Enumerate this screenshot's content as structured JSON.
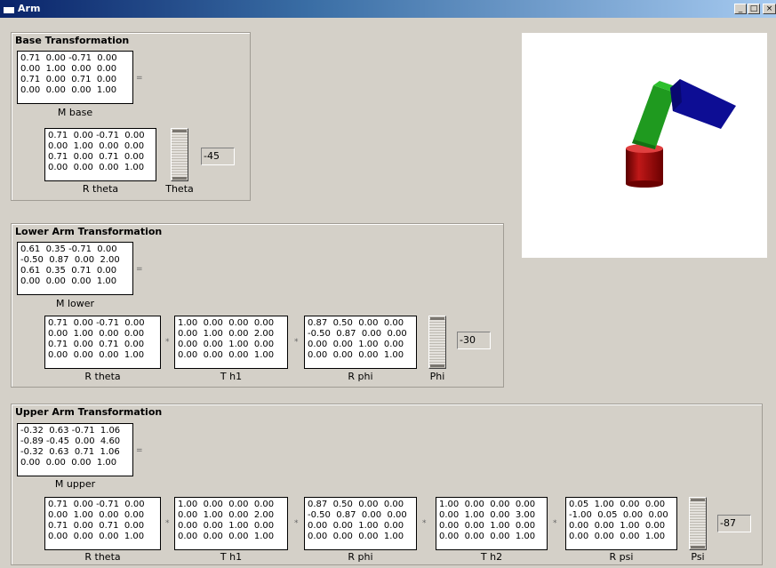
{
  "window": {
    "title": "Arm",
    "minimize": "_",
    "maximize": "□",
    "close": "×"
  },
  "base": {
    "title": "Base Transformation",
    "m_base": {
      "label": "M base",
      "rows": [
        "0.71  0.00 -0.71  0.00",
        "0.00  1.00  0.00  0.00",
        "0.71  0.00  0.71  0.00",
        "0.00  0.00  0.00  1.00"
      ]
    },
    "r_theta": {
      "label": "R theta",
      "rows": [
        "0.71  0.00 -0.71  0.00",
        "0.00  1.00  0.00  0.00",
        "0.71  0.00  0.71  0.00",
        "0.00  0.00  0.00  1.00"
      ]
    },
    "slider_label": "Theta",
    "value": "-45"
  },
  "lower": {
    "title": "Lower Arm Transformation",
    "m_lower": {
      "label": "M lower",
      "rows": [
        "0.61  0.35 -0.71  0.00",
        "-0.50  0.87  0.00  2.00",
        "0.61  0.35  0.71  0.00",
        "0.00  0.00  0.00  1.00"
      ]
    },
    "r_theta": {
      "label": "R theta",
      "rows": [
        "0.71  0.00 -0.71  0.00",
        "0.00  1.00  0.00  0.00",
        "0.71  0.00  0.71  0.00",
        "0.00  0.00  0.00  1.00"
      ]
    },
    "t_h1": {
      "label": "T h1",
      "rows": [
        "1.00  0.00  0.00  0.00",
        "0.00  1.00  0.00  2.00",
        "0.00  0.00  1.00  0.00",
        "0.00  0.00  0.00  1.00"
      ]
    },
    "r_phi": {
      "label": "R phi",
      "rows": [
        "0.87  0.50  0.00  0.00",
        "-0.50  0.87  0.00  0.00",
        "0.00  0.00  1.00  0.00",
        "0.00  0.00  0.00  1.00"
      ]
    },
    "slider_label": "Phi",
    "value": "-30"
  },
  "upper": {
    "title": "Upper Arm Transformation",
    "m_upper": {
      "label": "M upper",
      "rows": [
        "-0.32  0.63 -0.71  1.06",
        "-0.89 -0.45  0.00  4.60",
        "-0.32  0.63  0.71  1.06",
        "0.00  0.00  0.00  1.00"
      ]
    },
    "r_theta": {
      "label": "R theta",
      "rows": [
        "0.71  0.00 -0.71  0.00",
        "0.00  1.00  0.00  0.00",
        "0.71  0.00  0.71  0.00",
        "0.00  0.00  0.00  1.00"
      ]
    },
    "t_h1": {
      "label": "T h1",
      "rows": [
        "1.00  0.00  0.00  0.00",
        "0.00  1.00  0.00  2.00",
        "0.00  0.00  1.00  0.00",
        "0.00  0.00  0.00  1.00"
      ]
    },
    "r_phi": {
      "label": "R phi",
      "rows": [
        "0.87  0.50  0.00  0.00",
        "-0.50  0.87  0.00  0.00",
        "0.00  0.00  1.00  0.00",
        "0.00  0.00  0.00  1.00"
      ]
    },
    "t_h2": {
      "label": "T h2",
      "rows": [
        "1.00  0.00  0.00  0.00",
        "0.00  1.00  0.00  3.00",
        "0.00  0.00  1.00  0.00",
        "0.00  0.00  0.00  1.00"
      ]
    },
    "r_psi": {
      "label": "R psi",
      "rows": [
        "0.05  1.00  0.00  0.00",
        "-1.00  0.05  0.00  0.00",
        "0.00  0.00  1.00  0.00",
        "0.00  0.00  0.00  1.00"
      ]
    },
    "slider_label": "Psi",
    "value": "-87"
  },
  "operators": {
    "equals": "=",
    "times": "*"
  },
  "colors": {
    "base_cylinder": "#a01010",
    "lower_arm": "#1a8a1a",
    "upper_arm": "#0a0a8a"
  }
}
